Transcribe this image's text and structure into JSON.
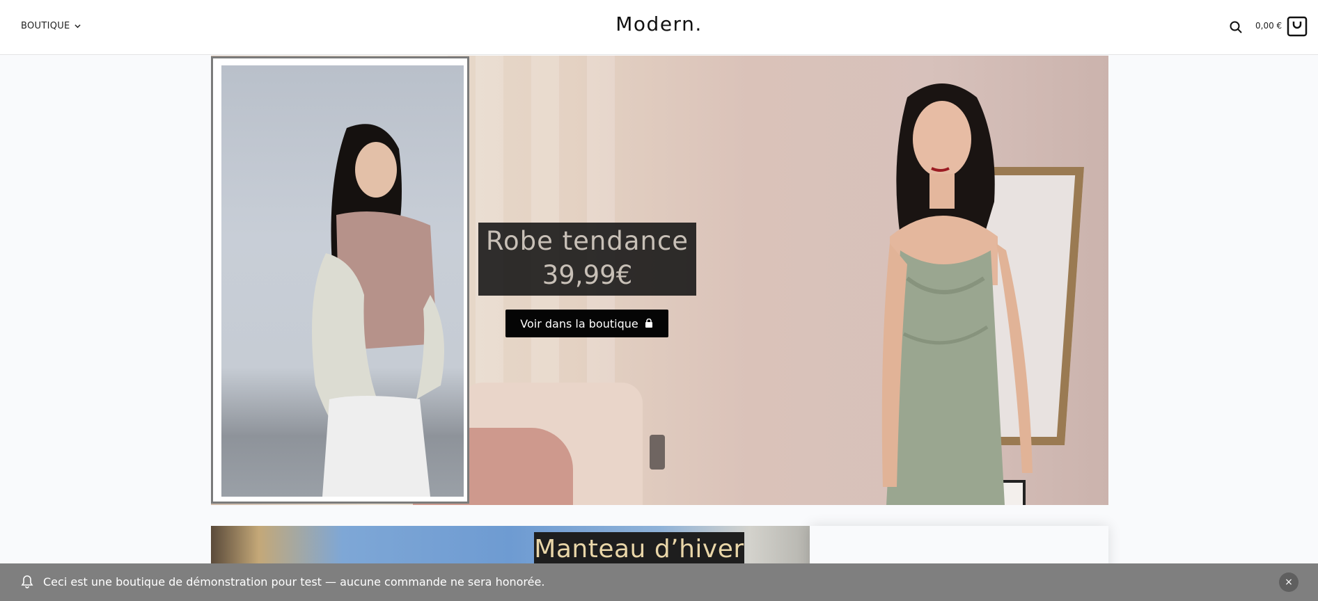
{
  "header": {
    "shop_menu_label": "BOUTIQUE",
    "logo": "Modern.",
    "cart_total": "0,00 €",
    "icons": {
      "search": "search-icon",
      "cart": "shopping-bag-icon",
      "chevron": "chevron-down-icon"
    }
  },
  "hero": {
    "caption_title": "Robe tendance",
    "caption_price": "39,99€",
    "cta_label": "Voir dans la boutique",
    "cta_icon": "shopping-bag-icon"
  },
  "row2": {
    "title": "Manteau d’hiver"
  },
  "notice": {
    "text": "Ceci est une boutique de démonstration pour test — aucune commande ne sera honorée.",
    "icon": "bell-icon",
    "close_icon": "close-icon",
    "close_label": "×"
  },
  "colors": {
    "notice_bg": "#7f7f7f",
    "caption_bg": "#141414",
    "cta_bg": "#050505",
    "row2_title_text": "#e9d6a8"
  }
}
